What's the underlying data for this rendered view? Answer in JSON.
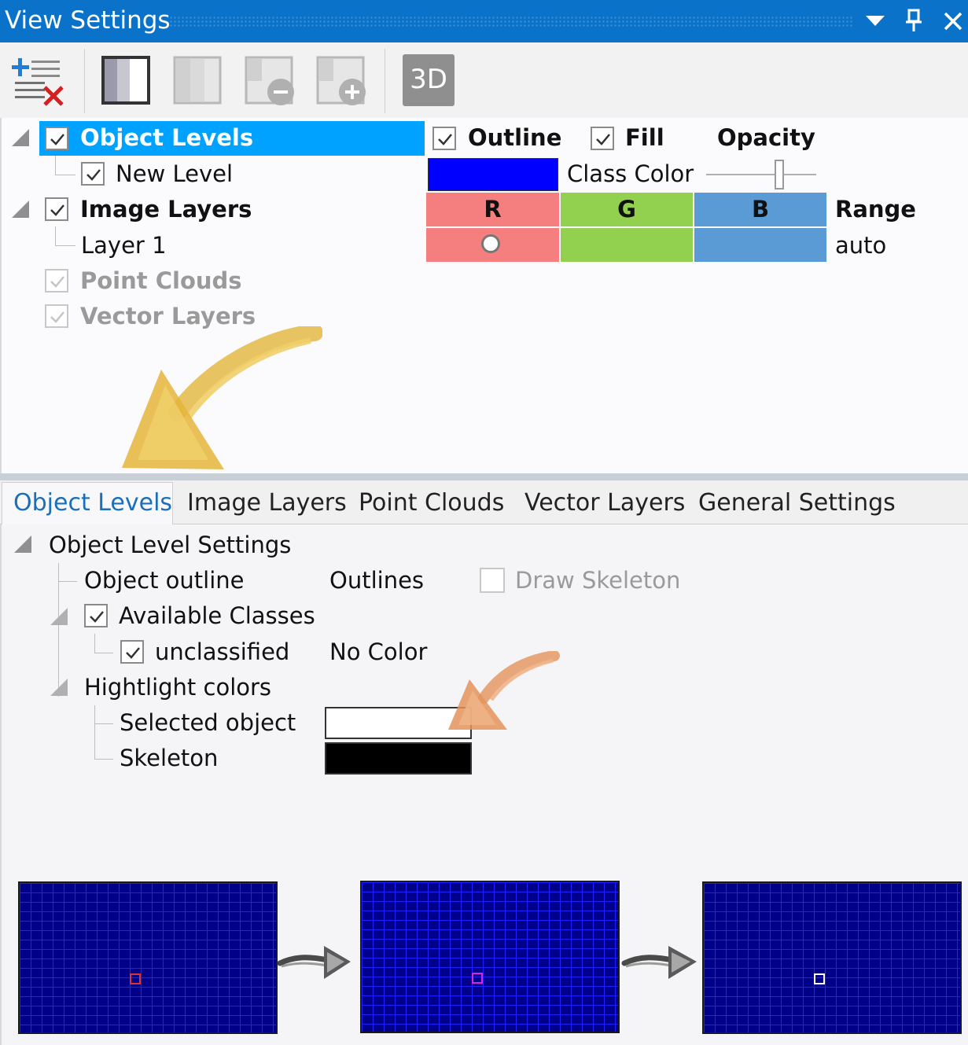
{
  "window": {
    "title": "View Settings"
  },
  "toolbar": {
    "three_d_label": "3D"
  },
  "tree": {
    "object_levels": "Object Levels",
    "new_level": "New Level",
    "image_layers": "Image Layers",
    "layer_1": "Layer 1",
    "point_clouds": "Point Clouds",
    "vector_layers": "Vector Layers"
  },
  "props": {
    "outline": "Outline",
    "fill": "Fill",
    "opacity": "Opacity",
    "class_color": "Class Color",
    "r": "R",
    "g": "G",
    "b": "B",
    "range": "Range",
    "range_value": "auto",
    "class_color_swatch": "#0000ff",
    "r_color": "#f57f7f",
    "g_color": "#92d050",
    "b_color": "#5b9bd5"
  },
  "tabs": [
    "Object Levels",
    "Image Layers",
    "Point Clouds",
    "Vector Layers",
    "General Settings"
  ],
  "settings": {
    "group_title": "Object Level Settings",
    "object_outline_label": "Object outline",
    "object_outline_value": "Outlines",
    "draw_skeleton": "Draw Skeleton",
    "available_classes": "Available Classes",
    "unclassified": "unclassified",
    "unclassified_color": "No Color",
    "highlight_colors": "Hightlight colors",
    "selected_object": "Selected object",
    "selected_object_color": "#ffffff",
    "skeleton": "Skeleton",
    "skeleton_color": "#000000"
  },
  "examples": {
    "marker_colors": [
      "#e03030",
      "#e020e0",
      "#ffffff"
    ]
  }
}
